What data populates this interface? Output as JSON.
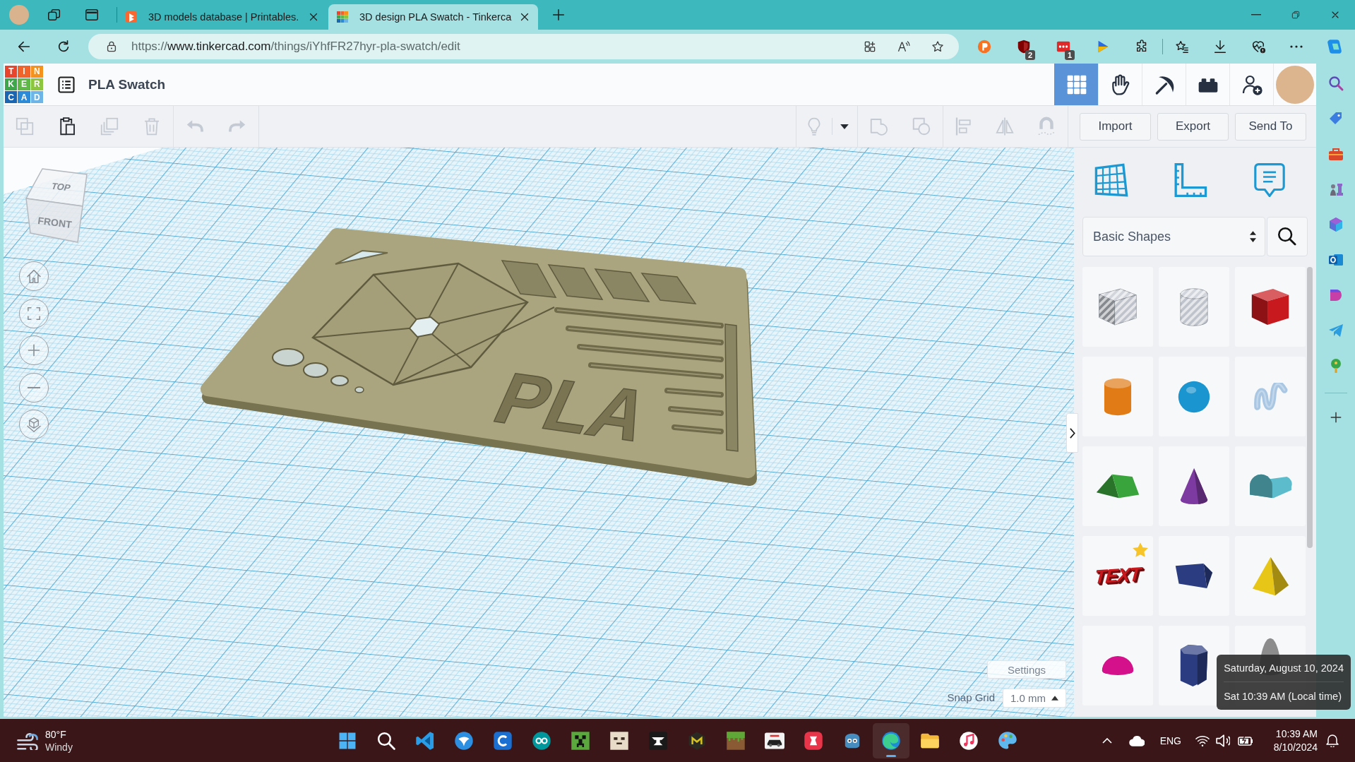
{
  "browser": {
    "tabs": [
      {
        "kind": "orange-logo",
        "title": "3D models database | Printables.",
        "selected": false
      },
      {
        "kind": "grid-logo",
        "title": "3D design PLA Swatch - Tinkerca",
        "selected": true
      }
    ],
    "address": {
      "scheme": "https://",
      "host": "www.tinkercad.com",
      "path": "/things/iYhfFR27hyr-pla-swatch/edit"
    },
    "extension_badges": [
      "2",
      "1"
    ]
  },
  "app": {
    "logo": [
      {
        "letter": "T",
        "color": "#e8452c"
      },
      {
        "letter": "I",
        "color": "#f0642b"
      },
      {
        "letter": "N",
        "color": "#f5921e"
      },
      {
        "letter": "K",
        "color": "#3ea74a"
      },
      {
        "letter": "E",
        "color": "#5fb946"
      },
      {
        "letter": "R",
        "color": "#8cc63f"
      },
      {
        "letter": "C",
        "color": "#1a66b3"
      },
      {
        "letter": "A",
        "color": "#2c8ad6"
      },
      {
        "letter": "D",
        "color": "#6db5e6"
      }
    ],
    "title": "PLA Swatch",
    "nav": [
      {
        "kind": "grid",
        "selected": true
      },
      {
        "kind": "hand",
        "selected": false
      },
      {
        "kind": "pickaxe",
        "selected": false
      },
      {
        "kind": "brick",
        "selected": false
      },
      {
        "kind": "add-user",
        "selected": false
      }
    ]
  },
  "toolbar": {
    "left_groups": [
      [
        {
          "kind": "copy",
          "disabled": true
        },
        {
          "kind": "paste",
          "disabled": false
        },
        {
          "kind": "duplicate",
          "disabled": true
        },
        {
          "kind": "delete",
          "disabled": true
        }
      ],
      [
        {
          "kind": "undo",
          "disabled": true
        },
        {
          "kind": "redo",
          "disabled": true
        }
      ]
    ],
    "right_groups": [
      [
        {
          "kind": "bulb",
          "disabled": true
        },
        {
          "kind": "caret",
          "disabled": false
        }
      ],
      [
        {
          "kind": "group",
          "disabled": true
        },
        {
          "kind": "ungroup",
          "disabled": true
        }
      ],
      [
        {
          "kind": "align",
          "disabled": true
        },
        {
          "kind": "mirror",
          "disabled": true
        },
        {
          "kind": "magnet",
          "disabled": true
        }
      ]
    ],
    "buttons": [
      "Import",
      "Export",
      "Send To"
    ]
  },
  "viewport": {
    "view_cube": {
      "top": "TOP",
      "front": "FRONT"
    },
    "model_text": "PLA",
    "settings": "Settings",
    "snap_grid": {
      "label": "Snap Grid",
      "value": "1.0 mm"
    }
  },
  "panel": {
    "category": "Basic Shapes",
    "shapes": [
      {
        "kind": "box",
        "color": "#bfc3cb",
        "hole": true,
        "starred": false
      },
      {
        "kind": "cylinder",
        "color": "#bfc3cb",
        "hole": true,
        "starred": false
      },
      {
        "kind": "box",
        "color": "#c8191f",
        "hole": false,
        "starred": false
      },
      {
        "kind": "cylinder",
        "color": "#e07b16",
        "hole": false,
        "starred": false
      },
      {
        "kind": "sphere",
        "color": "#1a95cf",
        "hole": false,
        "starred": false
      },
      {
        "kind": "scribble",
        "color": "#a9c7e3",
        "hole": false,
        "starred": false
      },
      {
        "kind": "roof",
        "color": "#3aa43c",
        "hole": false,
        "starred": false
      },
      {
        "kind": "cone",
        "color": "#7d3aa0",
        "hole": false,
        "starred": false
      },
      {
        "kind": "round-roof",
        "color": "#5cbccb",
        "hole": false,
        "starred": false
      },
      {
        "kind": "text",
        "label": "TEXT",
        "color": "#c8191f",
        "hole": false,
        "starred": true
      },
      {
        "kind": "polygon",
        "color": "#2b3d80",
        "hole": false,
        "starred": false
      },
      {
        "kind": "pyramid",
        "color": "#e8c617",
        "hole": false,
        "starred": false
      },
      {
        "kind": "half-sphere",
        "color": "#d4118a",
        "hole": false,
        "starred": false
      },
      {
        "kind": "hex-prism",
        "color": "#2b3d80",
        "hole": false,
        "starred": false
      },
      {
        "kind": "paraboloid",
        "color": "#8c8c8c",
        "hole": false,
        "starred": false
      }
    ]
  },
  "tooltip": {
    "lines": [
      "Saturday, August 10, 2024",
      "Sat 10:39 AM (Local time)"
    ]
  },
  "taskbar": {
    "weather": {
      "temperature": "80°F",
      "condition": "Windy"
    },
    "apps": [
      {
        "kind": "start",
        "selected": false
      },
      {
        "kind": "search",
        "selected": false
      },
      {
        "kind": "ribbon",
        "selected": false
      },
      {
        "kind": "circle-swirl",
        "selected": false
      },
      {
        "kind": "square-arc",
        "selected": false
      },
      {
        "kind": "infinity",
        "selected": false
      },
      {
        "kind": "creeper-face",
        "selected": false
      },
      {
        "kind": "block-face",
        "selected": false
      },
      {
        "kind": "anvil",
        "selected": false
      },
      {
        "kind": "hex-cube",
        "selected": false
      },
      {
        "kind": "grass-block",
        "selected": false
      },
      {
        "kind": "car",
        "selected": false
      },
      {
        "kind": "red-square",
        "selected": false
      },
      {
        "kind": "robot",
        "selected": false
      },
      {
        "kind": "browser",
        "selected": true
      },
      {
        "kind": "folder",
        "selected": false
      },
      {
        "kind": "music",
        "selected": false
      },
      {
        "kind": "palette",
        "selected": false
      }
    ],
    "language": "ENG",
    "clock": {
      "time": "10:39 AM",
      "date": "8/10/2024"
    }
  }
}
